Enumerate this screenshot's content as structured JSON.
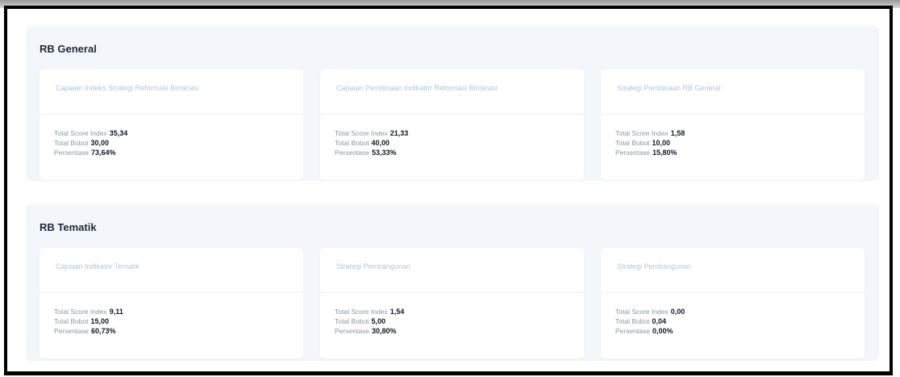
{
  "sections": [
    {
      "title": "RB General",
      "cards": [
        {
          "title": "Capaian Indeks Strategi Reformasi Birokrasi",
          "total_score_index": "35,34",
          "total_bobot": "30,00",
          "persentase": "73,64%"
        },
        {
          "title": "Capaian Pembinaan Indikator Reformasi Birokrasi",
          "total_score_index": "21,33",
          "total_bobot": "40,00",
          "persentase": "53,33%"
        },
        {
          "title": "Strategi Pembinaan RB General",
          "total_score_index": "1,58",
          "total_bobot": "10,00",
          "persentase": "15,80%"
        }
      ]
    },
    {
      "title": "RB Tematik",
      "cards": [
        {
          "title": "Capaian Indikator Tematik",
          "total_score_index": "9,11",
          "total_bobot": "15,00",
          "persentase": "60,73%"
        },
        {
          "title": "Strategi Pembangunan",
          "total_score_index": "1,54",
          "total_bobot": "5,00",
          "persentase": "30,80%"
        },
        {
          "title": "Strategi Pembangunan",
          "total_score_index": "0,00",
          "total_bobot": "0,04",
          "persentase": "0,00%"
        }
      ]
    }
  ],
  "labels": {
    "total_score_index": "Total Score Index",
    "total_bobot": "Total Bobot",
    "persentase": "Persentase"
  }
}
